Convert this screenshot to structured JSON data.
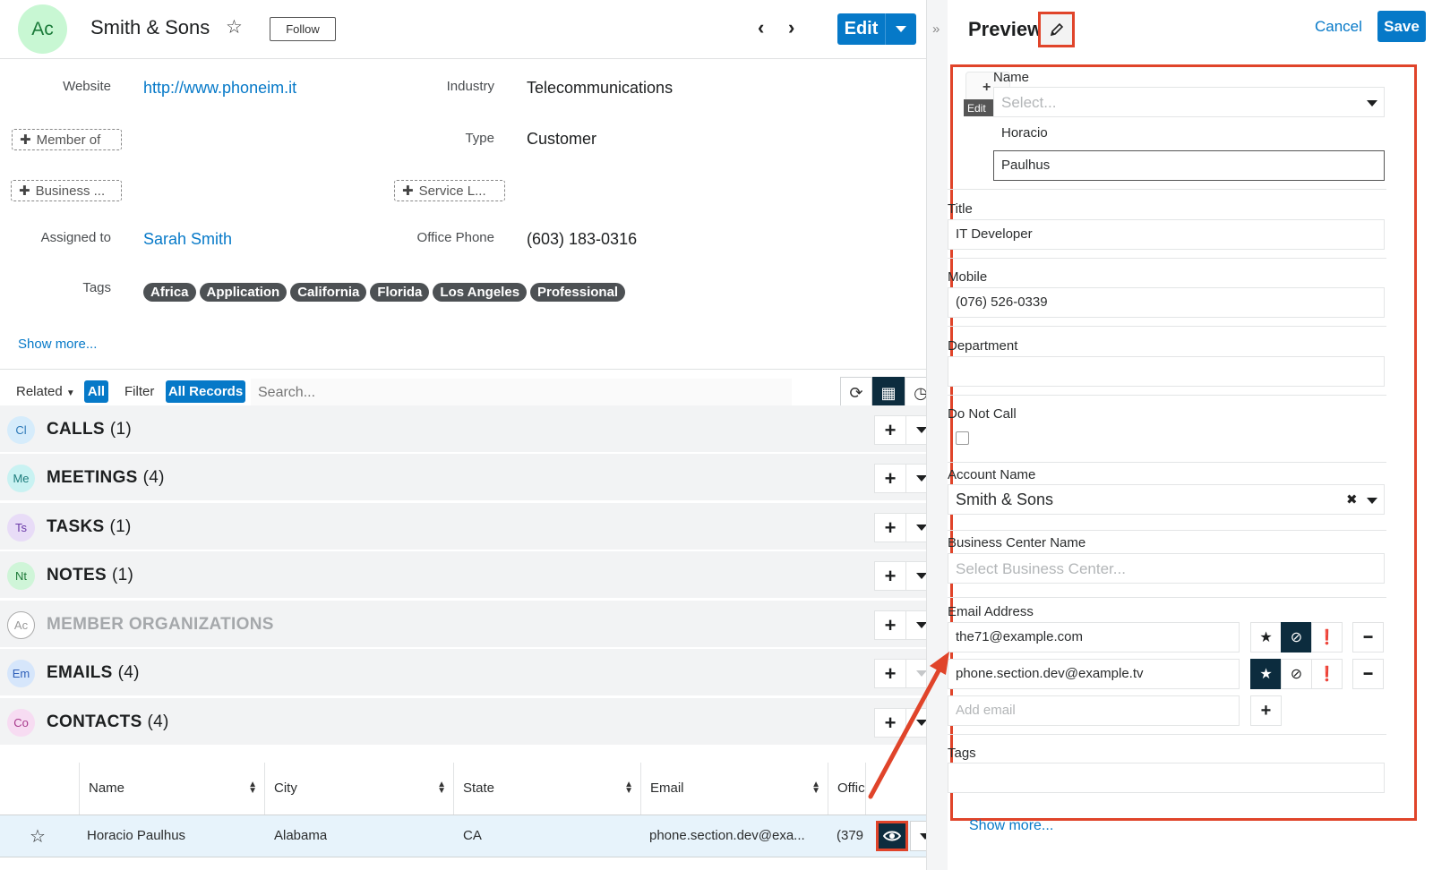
{
  "record": {
    "avatar": "Ac",
    "title": "Smith & Sons",
    "follow_label": "Follow",
    "edit_label": "Edit",
    "website_label": "Website",
    "website_value": "http://www.phoneim.it",
    "industry_label": "Industry",
    "industry_value": "Telecommunications",
    "member_of_label": "Member of",
    "type_label": "Type",
    "type_value": "Customer",
    "business_label": "Business ...",
    "service_label": "Service L...",
    "assigned_label": "Assigned to",
    "assigned_value": "Sarah Smith",
    "office_phone_label": "Office Phone",
    "office_phone_value": "(603) 183-0316",
    "tags_label": "Tags",
    "tags": [
      "Africa",
      "Application",
      "California",
      "Florida",
      "Los Angeles",
      "Professional"
    ],
    "show_more": "Show more..."
  },
  "toolbar": {
    "related_label": "Related",
    "all_label": "All",
    "filter_label": "Filter",
    "all_records_label": "All Records",
    "search_placeholder": "Search..."
  },
  "subpanels": [
    {
      "avatar": "Cl",
      "name": "CALLS",
      "count": "(1)",
      "color": "#d6ecfb",
      "fg": "#2e7ab8"
    },
    {
      "avatar": "Me",
      "name": "MEETINGS",
      "count": "(4)",
      "color": "#c9f2f2",
      "fg": "#1d7c7c"
    },
    {
      "avatar": "Ts",
      "name": "TASKS",
      "count": "(1)",
      "color": "#e8dcf7",
      "fg": "#6a3aa8"
    },
    {
      "avatar": "Nt",
      "name": "NOTES",
      "count": "(1)",
      "color": "#cff5d8",
      "fg": "#1e7a39"
    },
    {
      "avatar": "Ac",
      "name": "MEMBER ORGANIZATIONS",
      "count": "",
      "color": "#ffffff",
      "fg": "#999999"
    },
    {
      "avatar": "Em",
      "name": "EMAILS",
      "count": "(4)",
      "color": "#d6e6fb",
      "fg": "#2e5fb8"
    },
    {
      "avatar": "Co",
      "name": "CONTACTS",
      "count": "(4)",
      "color": "#f7dcf2",
      "fg": "#a83a8c"
    }
  ],
  "contacts_table": {
    "headers": [
      "Name",
      "City",
      "State",
      "Email",
      "Offic"
    ],
    "row": {
      "name": "Horacio Paulhus",
      "city": "Alabama",
      "state": "CA",
      "email": "phone.section.dev@exa...",
      "office": "(379"
    }
  },
  "preview": {
    "title": "Preview",
    "cancel_label": "Cancel",
    "save_label": "Save",
    "photo_edit_label": "Edit",
    "name_label": "Name",
    "salutation_placeholder": "Select...",
    "first_name": "Horacio",
    "last_name": "Paulhus",
    "title_label": "Title",
    "title_value": "IT Developer",
    "mobile_label": "Mobile",
    "mobile_value": "(076) 526-0339",
    "department_label": "Department",
    "do_not_call_label": "Do Not Call",
    "account_name_label": "Account Name",
    "account_name_value": "Smith & Sons",
    "business_center_label": "Business Center Name",
    "business_center_placeholder": "Select Business Center...",
    "email_label": "Email Address",
    "emails": [
      "the71@example.com",
      "phone.section.dev@example.tv"
    ],
    "add_email_placeholder": "Add email",
    "tags_label": "Tags",
    "show_more": "Show more..."
  },
  "colors": {
    "accent": "#0679c8",
    "highlight": "#e0442a",
    "dark_button": "#0c2c3e"
  }
}
